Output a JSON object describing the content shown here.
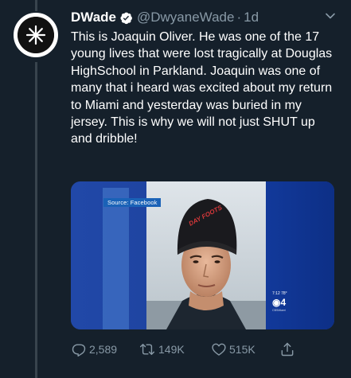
{
  "author": {
    "display_name": "DWade",
    "handle": "@DwyaneWade",
    "separator": "·",
    "timestamp": "1d"
  },
  "tweet": {
    "text": "This is Joaquin Oliver. He was one of the 17 young lives that were lost tragically at Douglas HighSchool in Parkland. Joaquin was one of many that i heard was excited about my return to Miami and yesterday was buried in my jersey. This is why we will not just SHUT up and dribble!"
  },
  "media": {
    "source_label": "Source: Facebook",
    "beanie_text": "DAY FOOTS"
  },
  "actions": {
    "reply_count": "2,589",
    "retweet_count": "149K",
    "like_count": "515K"
  },
  "colors": {
    "background": "#15202b",
    "text": "#ffffff",
    "secondary": "#8899a6",
    "verified": "#ffffff"
  },
  "icons": [
    "verified-badge-icon",
    "caret-down-icon",
    "reply-icon",
    "retweet-icon",
    "like-icon",
    "share-icon"
  ]
}
